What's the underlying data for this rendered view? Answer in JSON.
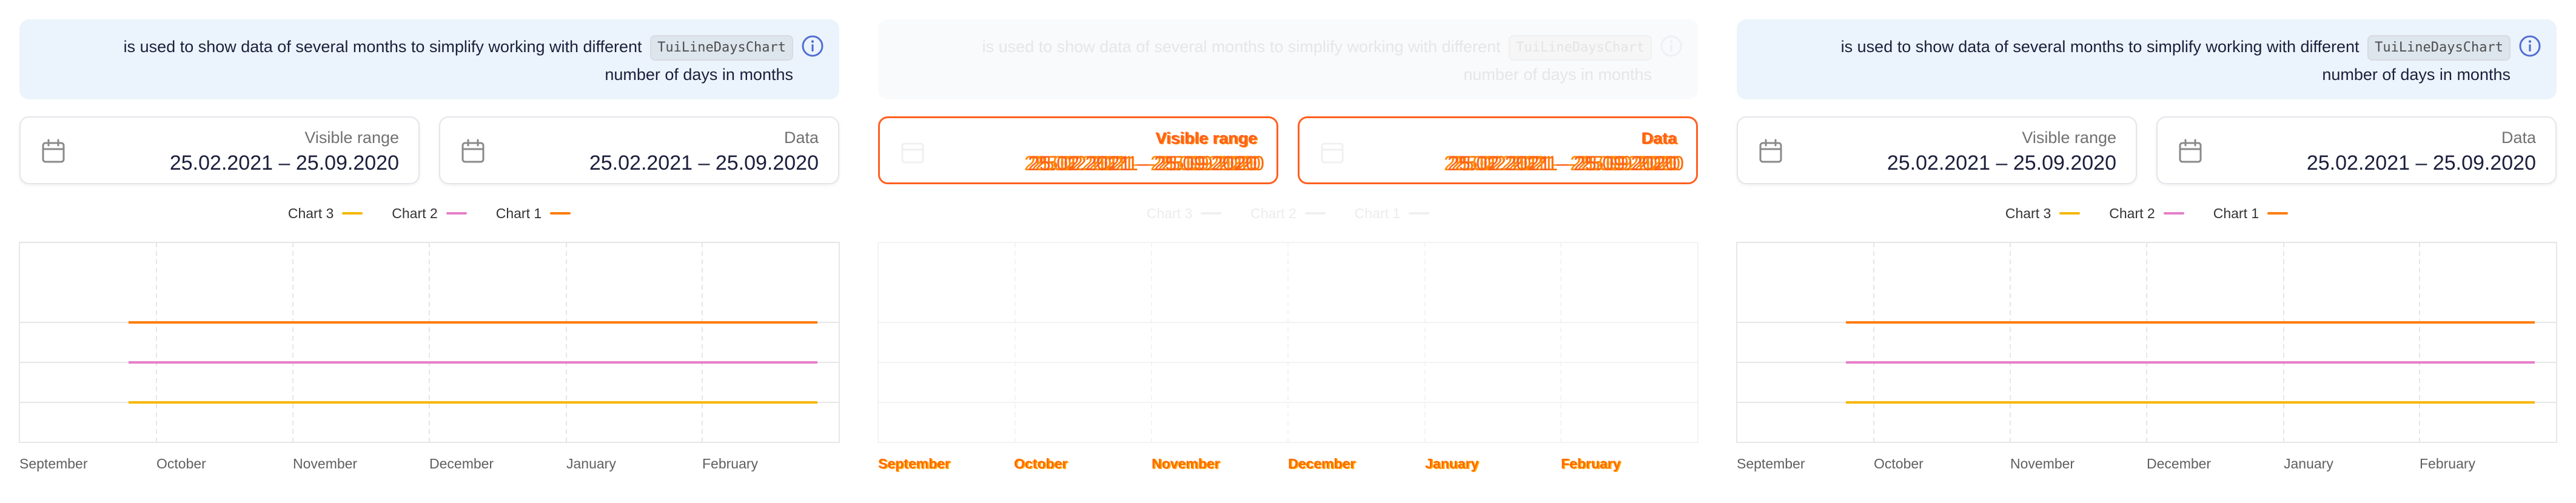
{
  "notice": {
    "text": "is used to show data of several months to simplify working with different",
    "code": "TuiLineDaysChart",
    "text_end": "number of days in months",
    "icon": "info-icon"
  },
  "fields": {
    "visible_range": {
      "label": "Visible range",
      "value": "25.02.2021 – 25.09.2020",
      "icon": "calendar-icon"
    },
    "data": {
      "label": "Data",
      "value": "25.02.2021 – 25.09.2020",
      "icon": "calendar-icon"
    }
  },
  "legend": [
    {
      "name": "Chart 3",
      "color": "#f5b800"
    },
    {
      "name": "Chart 2",
      "color": "#e67fc9"
    },
    {
      "name": "Chart 1",
      "color": "#ff7c0a"
    }
  ],
  "months": [
    "September",
    "October",
    "November",
    "December",
    "January",
    "February"
  ],
  "colors": {
    "notice_bg": "#ebf4fc",
    "accent": "#526ed3",
    "loading_orange": "#ff5f1f"
  },
  "chart_data": {
    "type": "line",
    "x": [
      "September",
      "October",
      "November",
      "December",
      "January",
      "February"
    ],
    "series": [
      {
        "name": "Chart 1",
        "values": [
          null,
          3,
          3,
          3,
          3,
          3
        ],
        "color": "#ff7c0a"
      },
      {
        "name": "Chart 2",
        "values": [
          null,
          2,
          2,
          2,
          2,
          2
        ],
        "color": "#e67fc9"
      },
      {
        "name": "Chart 3",
        "values": [
          null,
          1,
          1,
          1,
          1,
          1
        ],
        "color": "#f5b800"
      }
    ],
    "ylim": [
      0,
      5
    ],
    "grid": true,
    "legend_position": "top-center"
  }
}
